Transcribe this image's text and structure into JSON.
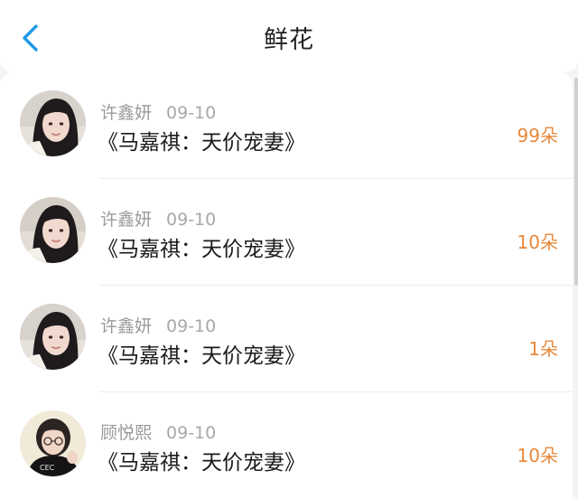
{
  "header": {
    "title": "鲜花",
    "back_icon": "chevron-left-icon",
    "accent": "#1e9be8"
  },
  "colors": {
    "count": "#e8883a",
    "meta": "#9a9a9a",
    "title": "#1a1a1a"
  },
  "items": [
    {
      "user": "许鑫妍",
      "date": "09-10",
      "book": "《马嘉祺：天价宠妻》",
      "count": "99朵",
      "avatar": "avatar-photo"
    },
    {
      "user": "许鑫妍",
      "date": "09-10",
      "book": "《马嘉祺：天价宠妻》",
      "count": "10朵",
      "avatar": "avatar-photo"
    },
    {
      "user": "许鑫妍",
      "date": "09-10",
      "book": "《马嘉祺：天价宠妻》",
      "count": "1朵",
      "avatar": "avatar-photo"
    },
    {
      "user": "顾悦熙",
      "date": "09-10",
      "book": "《马嘉祺：天价宠妻》",
      "count": "10朵",
      "avatar": "avatar-photo"
    }
  ]
}
